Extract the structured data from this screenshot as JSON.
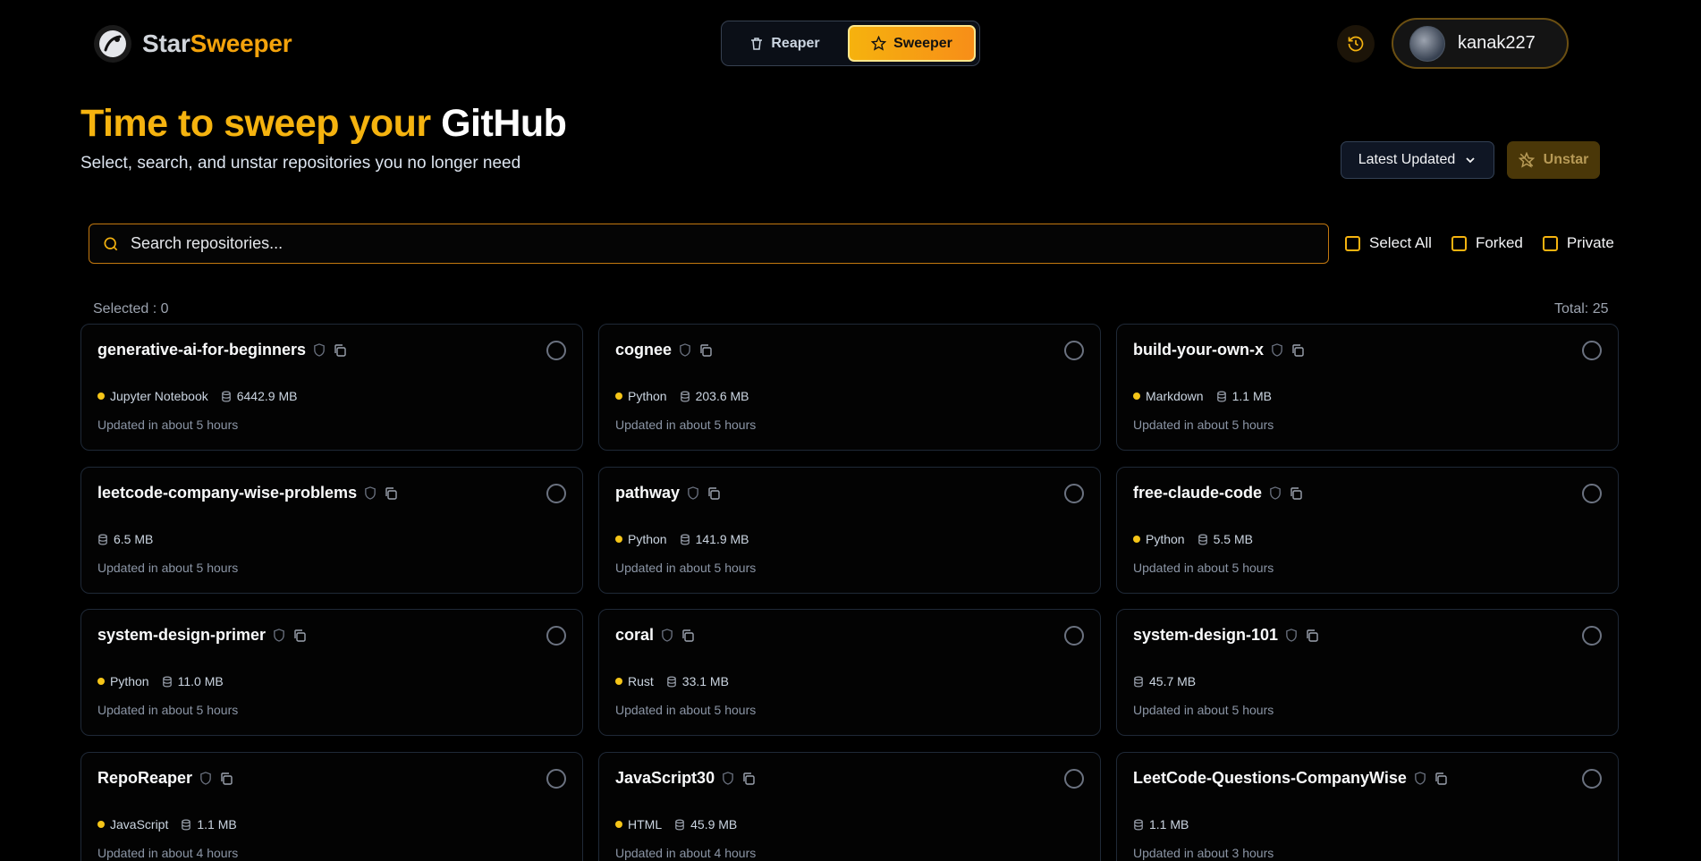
{
  "brand": {
    "part1": "Star",
    "part2": "Sweeper"
  },
  "modes": {
    "reaper": "Reaper",
    "sweeper": "Sweeper"
  },
  "user": {
    "name": "kanak227"
  },
  "hero": {
    "title_part1": "Time to sweep your",
    "title_part2": "GitHub",
    "subtitle": "Select, search, and unstar repositories you no longer need"
  },
  "controls": {
    "sort_label": "Latest Updated",
    "unstar_label": "Unstar",
    "search_placeholder": "Search repositories..."
  },
  "filters": {
    "select_all": "Select All",
    "forked": "Forked",
    "private": "Private"
  },
  "counts": {
    "selected": "Selected : 0",
    "total": "Total: 25"
  },
  "repos": [
    {
      "name": "generative-ai-for-beginners",
      "language": "Jupyter Notebook",
      "size": "6442.9 MB",
      "updated": "Updated in about 5 hours"
    },
    {
      "name": "cognee",
      "language": "Python",
      "size": "203.6 MB",
      "updated": "Updated in about 5 hours"
    },
    {
      "name": "build-your-own-x",
      "language": "Markdown",
      "size": "1.1 MB",
      "updated": "Updated in about 5 hours"
    },
    {
      "name": "leetcode-company-wise-problems",
      "language": "",
      "size": "6.5 MB",
      "updated": "Updated in about 5 hours"
    },
    {
      "name": "pathway",
      "language": "Python",
      "size": "141.9 MB",
      "updated": "Updated in about 5 hours"
    },
    {
      "name": "free-claude-code",
      "language": "Python",
      "size": "5.5 MB",
      "updated": "Updated in about 5 hours"
    },
    {
      "name": "system-design-primer",
      "language": "Python",
      "size": "11.0 MB",
      "updated": "Updated in about 5 hours"
    },
    {
      "name": "coral",
      "language": "Rust",
      "size": "33.1 MB",
      "updated": "Updated in about 5 hours"
    },
    {
      "name": "system-design-101",
      "language": "",
      "size": "45.7 MB",
      "updated": "Updated in about 5 hours"
    },
    {
      "name": "RepoReaper",
      "language": "JavaScript",
      "size": "1.1 MB",
      "updated": "Updated in about 4 hours"
    },
    {
      "name": "JavaScript30",
      "language": "HTML",
      "size": "45.9 MB",
      "updated": "Updated in about 4 hours"
    },
    {
      "name": "LeetCode-Questions-CompanyWise",
      "language": "",
      "size": "1.1 MB",
      "updated": "Updated in about 3 hours"
    }
  ],
  "colors": {
    "accent": "#f5b30f",
    "accent_orange": "#f78e18",
    "language_dot": "#f5c518"
  }
}
